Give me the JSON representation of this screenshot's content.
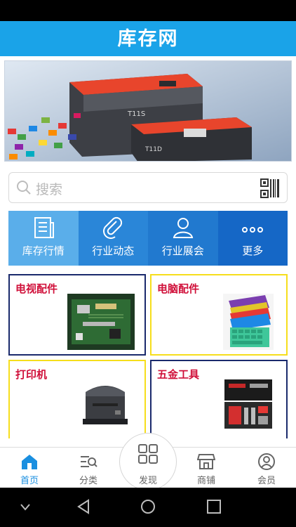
{
  "header": {
    "title": "库存网"
  },
  "search": {
    "placeholder": "搜索",
    "icon": "search-icon",
    "scan_icon": "qr-code-icon"
  },
  "menu": [
    {
      "label": "库存行情",
      "icon": "newspaper-icon",
      "color": "#5aaeea"
    },
    {
      "label": "行业动态",
      "icon": "paperclip-icon",
      "color": "#2a86d8"
    },
    {
      "label": "行业展会",
      "icon": "user-icon",
      "color": "#2179cf"
    },
    {
      "label": "更多",
      "icon": "more-dots-icon",
      "color": "#1567c6"
    }
  ],
  "categories": [
    {
      "label": "电视配件",
      "image": "circuit-board-image"
    },
    {
      "label": "电脑配件",
      "image": "keyboard-image"
    },
    {
      "label": "打印机",
      "image": "label-printer-image"
    },
    {
      "label": "五金工具",
      "image": "toolkit-image"
    }
  ],
  "tabbar": [
    {
      "label": "首页",
      "icon": "home-icon",
      "active": true
    },
    {
      "label": "分类",
      "icon": "category-list-icon",
      "active": false
    },
    {
      "label": "发现",
      "icon": "grid-icon",
      "active": false
    },
    {
      "label": "商铺",
      "icon": "shop-icon",
      "active": false
    },
    {
      "label": "会员",
      "icon": "member-icon",
      "active": false
    }
  ],
  "colors": {
    "brand": "#1aa3e8",
    "category_text": "#d0103a",
    "active_tab": "#1a8fe0",
    "tab_text": "#666666"
  }
}
